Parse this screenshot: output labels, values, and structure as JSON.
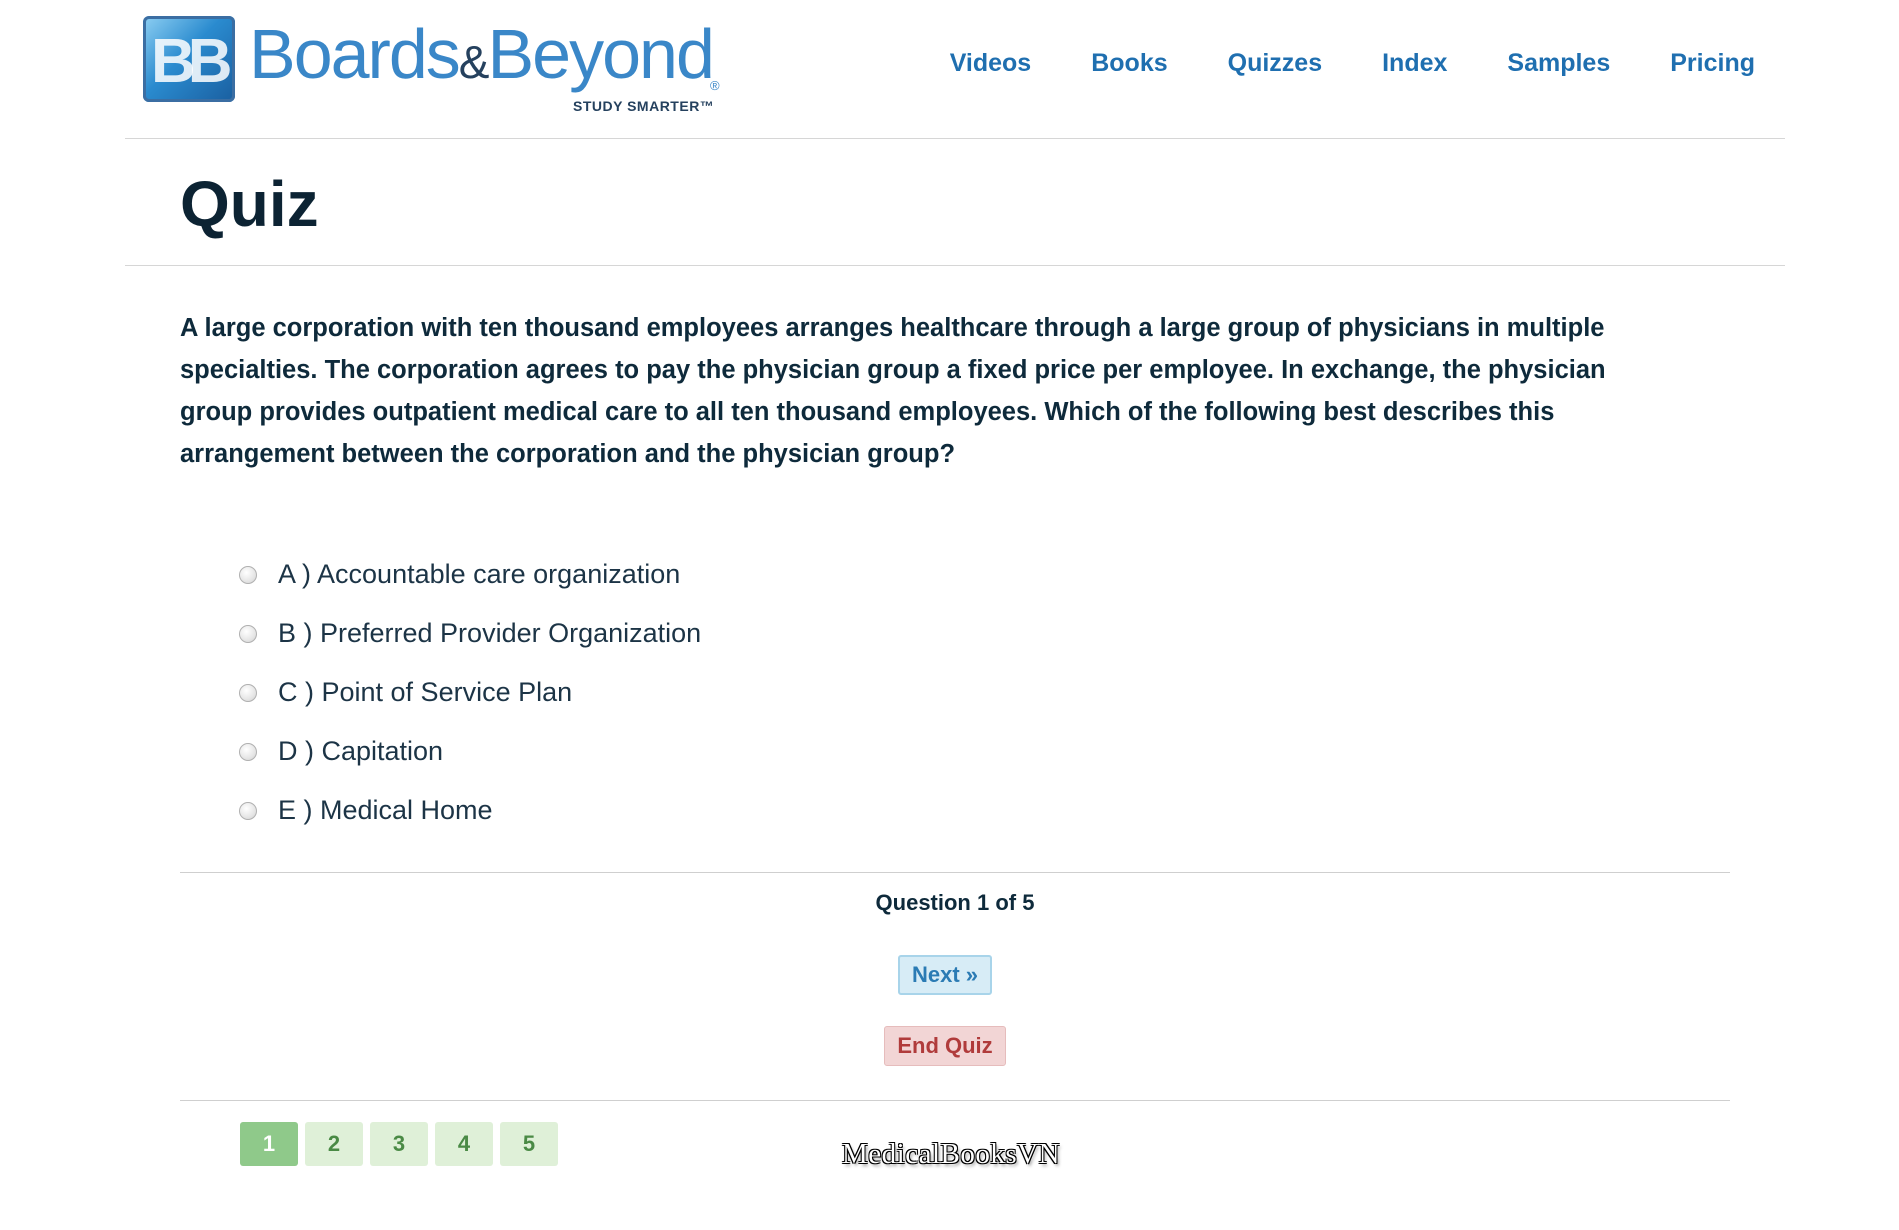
{
  "header": {
    "logo": {
      "brand": "Boards",
      "amp": "&",
      "brand2": "Beyond",
      "tagline": "STUDY SMARTER™",
      "reg": "®"
    },
    "nav": [
      "Videos",
      "Books",
      "Quizzes",
      "Index",
      "Samples",
      "Pricing"
    ]
  },
  "main": {
    "title": "Quiz",
    "question": "A large corporation with ten thousand employees arranges healthcare through a large group of physicians in multiple specialties. The corporation agrees to pay the physician group a fixed price per employee. In exchange, the physician group provides outpatient medical care to all ten thousand employees. Which of the following best describes this arrangement between the corporation and the physician group?",
    "options": [
      "A ) Accountable care organization",
      "B ) Preferred Provider Organization",
      "C ) Point of Service Plan",
      "D ) Capitation",
      "E ) Medical Home"
    ],
    "progress": "Question 1 of 5",
    "next_label": "Next »",
    "end_label": "End Quiz",
    "pages": [
      "1",
      "2",
      "3",
      "4",
      "5"
    ],
    "active_page": "1"
  },
  "watermark": "MedicalBooksVN",
  "colors": {
    "nav_link": "#1f6fb0",
    "title": "#0c2333",
    "next_bg": "#d7ecf6",
    "end_bg": "#f2d5d5",
    "page_active": "#8fc98a",
    "page_inactive": "#dff0d8"
  }
}
